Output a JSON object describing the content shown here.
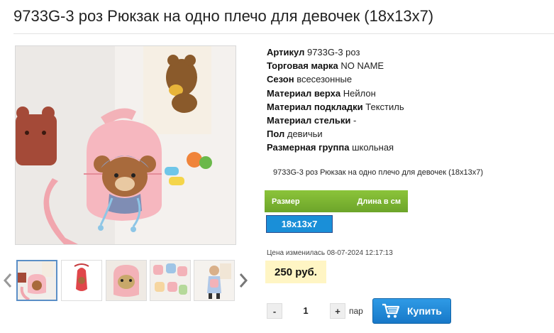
{
  "product": {
    "title": "9733G-3 роз Рюкзак на одно плечо для девочек (18х13х7)",
    "description": "9733G-3 роз Рюкзак на одно плечо для девочек (18х13х7)"
  },
  "specs": [
    {
      "label": "Артикул",
      "value": "9733G-3 роз"
    },
    {
      "label": "Торговая марка",
      "value": "NO NAME"
    },
    {
      "label": "Сезон",
      "value": "всесезонные"
    },
    {
      "label": "Материал верха",
      "value": "Нейлон"
    },
    {
      "label": "Материал подкладки",
      "value": "Текстиль"
    },
    {
      "label": "Материал стельки",
      "value": "-"
    },
    {
      "label": "Пол",
      "value": "девичьи"
    },
    {
      "label": "Размерная группа",
      "value": "школьная"
    }
  ],
  "size_table": {
    "col_size": "Размер",
    "col_length": "Длина в см",
    "selected_size": "18х13х7"
  },
  "pricing": {
    "changed_note": "Цена изменилась 08-07-2024 12:17:13",
    "price": "250 руб."
  },
  "quantity": {
    "minus": "-",
    "value": "1",
    "plus": "+",
    "unit": "пар"
  },
  "buy_button": {
    "label": "Купить"
  },
  "colors": {
    "accent_green": "#7bb534",
    "accent_blue": "#1a8fd8",
    "price_bg": "#fff5c4"
  }
}
